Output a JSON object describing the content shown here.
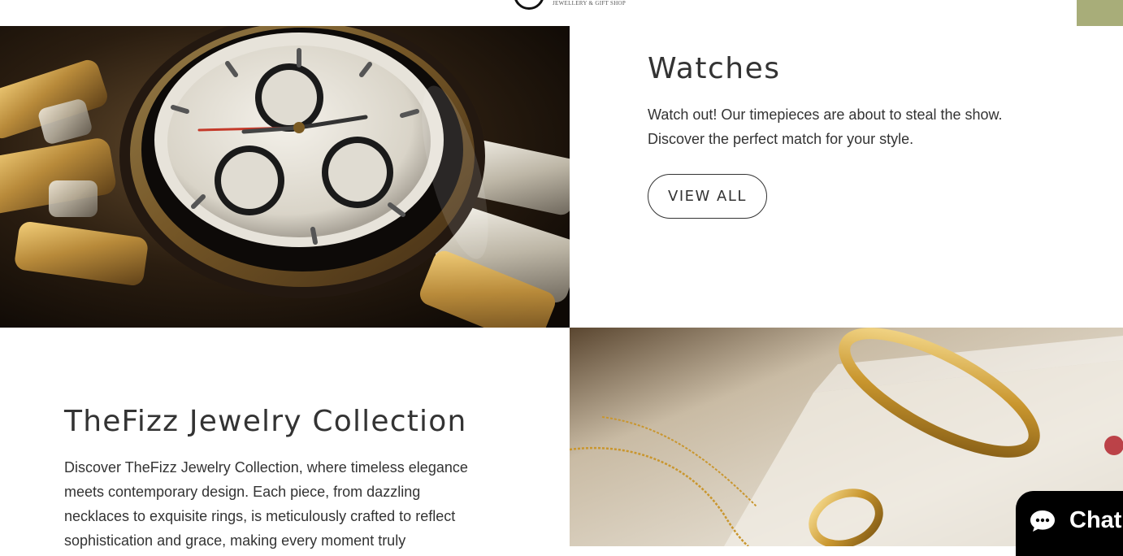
{
  "header": {
    "logo_tagline": "JEWELLERY & GIFT SHOP",
    "accent_color": "#a8ad79"
  },
  "watches": {
    "title": "Watches",
    "description_line1": "Watch out! Our timepieces are about to steal the show.",
    "description_line2": "Discover the perfect match for your style.",
    "button_label": "VIEW ALL"
  },
  "jewelry": {
    "title": "TheFizz Jewelry Collection",
    "description_line1": "Discover TheFizz Jewelry Collection, where timeless elegance",
    "description_line2": "meets contemporary design. Each piece, from dazzling",
    "description_line3": "necklaces to exquisite rings, is meticulously crafted to reflect",
    "description_line4": "sophistication and grace, making every moment truly"
  },
  "chat": {
    "label": "Chat",
    "icon": "chat-bubble-icon"
  }
}
